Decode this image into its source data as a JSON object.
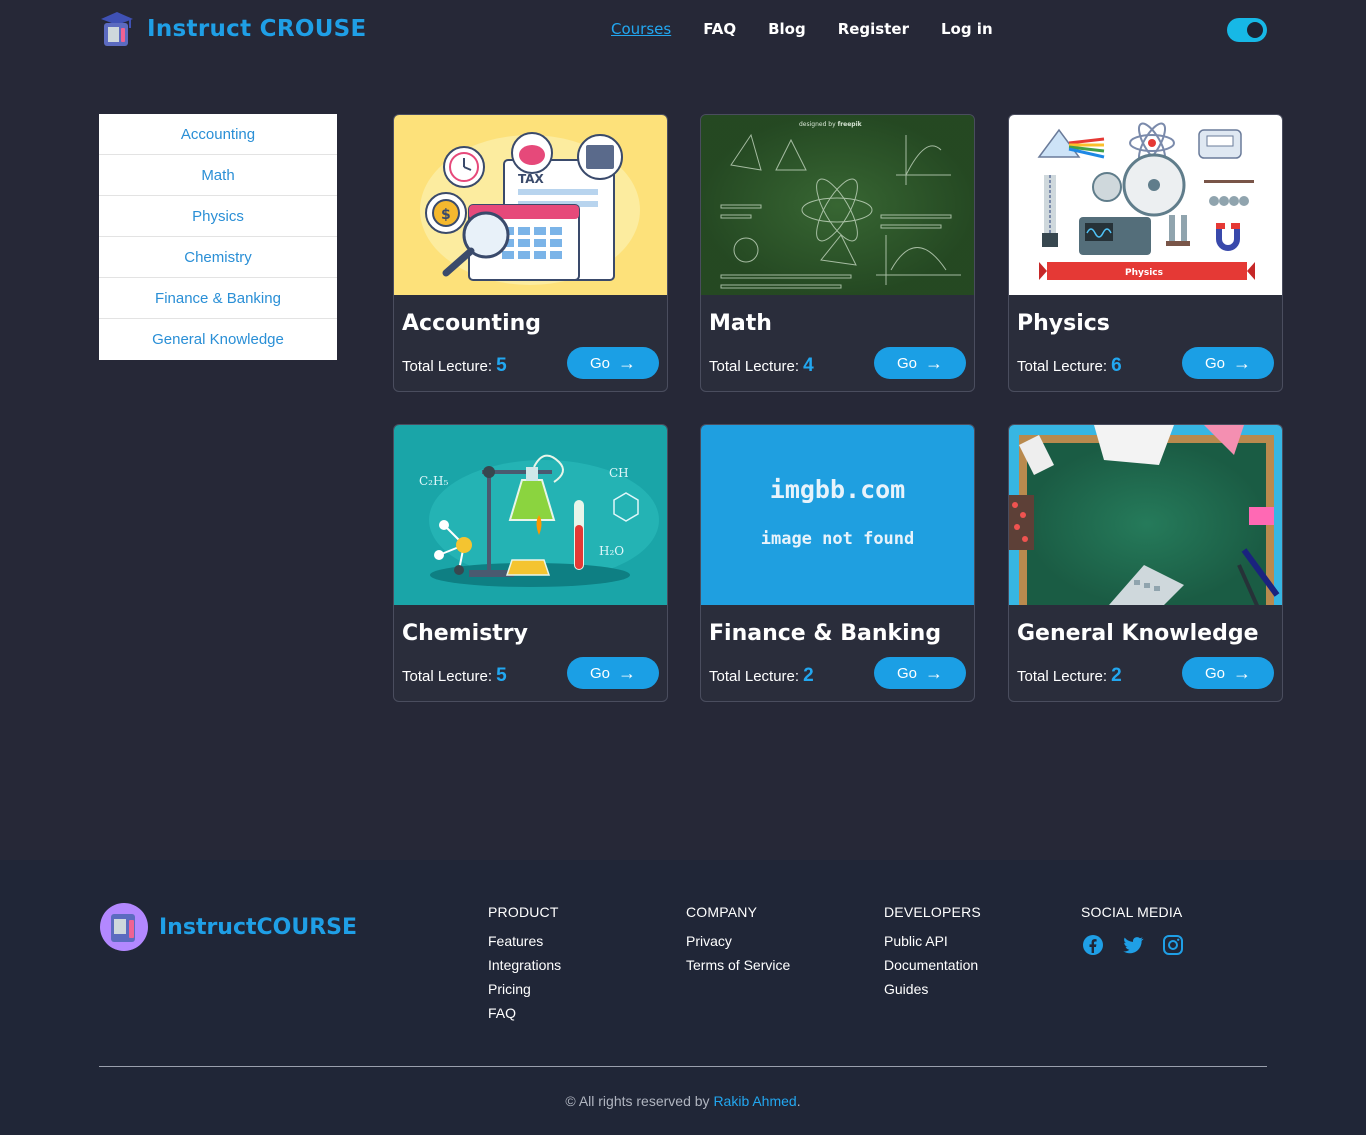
{
  "brand": {
    "name": "Instruct CROUSE",
    "accent": "#1f9fe6"
  },
  "nav": [
    {
      "label": "Courses",
      "active": true
    },
    {
      "label": "FAQ"
    },
    {
      "label": "Blog"
    },
    {
      "label": "Register"
    },
    {
      "label": "Log in"
    }
  ],
  "theme_toggle": {
    "on": true,
    "color": "#17b8e6"
  },
  "sidebar": {
    "items": [
      {
        "label": "Accounting"
      },
      {
        "label": "Math"
      },
      {
        "label": "Physics"
      },
      {
        "label": "Chemistry"
      },
      {
        "label": "Finance & Banking"
      },
      {
        "label": "General Knowledge"
      }
    ]
  },
  "courses": [
    {
      "title": "Accounting",
      "lecture_label": "Total Lecture:",
      "lectures": "5",
      "button": "Go"
    },
    {
      "title": "Math",
      "lecture_label": "Total Lecture:",
      "lectures": "4",
      "button": "Go"
    },
    {
      "title": "Physics",
      "lecture_label": "Total Lecture:",
      "lectures": "6",
      "button": "Go"
    },
    {
      "title": "Chemistry",
      "lecture_label": "Total Lecture:",
      "lectures": "5",
      "button": "Go"
    },
    {
      "title": "Finance & Banking",
      "lecture_label": "Total Lecture:",
      "lectures": "2",
      "button": "Go",
      "image_text": [
        "imgbb.com",
        "image not found"
      ]
    },
    {
      "title": "General Knowledge",
      "lecture_label": "Total Lecture:",
      "lectures": "2",
      "button": "Go"
    }
  ],
  "thumb_texts": {
    "accounting_tax": "TAX",
    "math_credit": "designed by",
    "math_freepik": "freepik",
    "physics_banner": "Physics"
  },
  "footer": {
    "brand": "InstructCOURSE",
    "columns": [
      {
        "heading": "PRODUCT",
        "links": [
          "Features",
          "Integrations",
          "Pricing",
          "FAQ"
        ]
      },
      {
        "heading": "COMPANY",
        "links": [
          "Privacy",
          "Terms of Service"
        ]
      },
      {
        "heading": "DEVELOPERS",
        "links": [
          "Public API",
          "Documentation",
          "Guides"
        ]
      }
    ],
    "social_heading": "SOCIAL MEDIA",
    "social_icons": [
      "facebook-icon",
      "twitter-icon",
      "instagram-icon"
    ],
    "copyright_prefix": "© All rights reserved by",
    "author": "Rakib Ahmed",
    "copyright_suffix": "."
  }
}
